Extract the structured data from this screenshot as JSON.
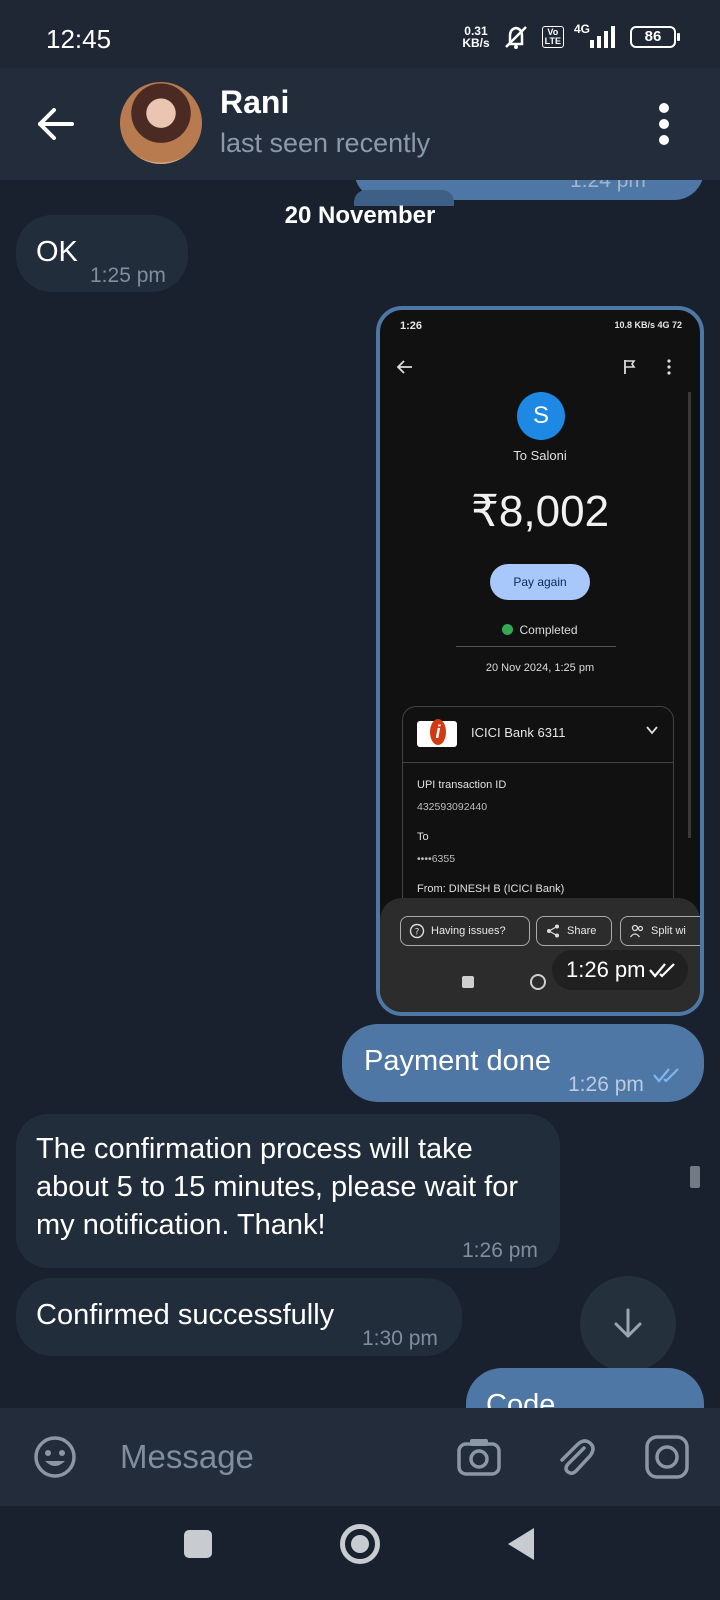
{
  "status_bar": {
    "time": "12:45",
    "speed_value": "0.31",
    "speed_unit": "KB/s",
    "volte_top": "Vo",
    "volte_bottom": "LTE",
    "network": "4G",
    "battery": "86"
  },
  "header": {
    "contact_name": "Rani",
    "contact_status": "last seen recently"
  },
  "chat": {
    "partial_time": "1:24 pm",
    "date_separator": "20 November",
    "messages": [
      {
        "direction": "incoming",
        "text": "OK",
        "time": "1:25 pm"
      },
      {
        "direction": "outgoing",
        "type": "image",
        "time": "1:26 pm"
      },
      {
        "direction": "outgoing",
        "text": "Payment done",
        "time": "1:26 pm"
      },
      {
        "direction": "incoming",
        "text": "The confirmation process will take about 5 to 15 minutes, please wait for my notification. Thank!",
        "time": "1:26 pm"
      },
      {
        "direction": "incoming",
        "text": "Confirmed successfully",
        "time": "1:30 pm"
      },
      {
        "direction": "outgoing",
        "text": "Code",
        "time": ""
      }
    ]
  },
  "payment_screenshot": {
    "status_time": "1:26",
    "status_right": "10.8 KB/s  4G  72",
    "avatar_letter": "S",
    "recipient": "To Saloni",
    "amount": "₹8,002",
    "pay_again_label": "Pay again",
    "status": "Completed",
    "datetime": "20 Nov 2024, 1:25 pm",
    "bank": "ICICI Bank 6311",
    "upi_label": "UPI transaction ID",
    "upi_id": "432593092440",
    "to_label": "To",
    "to_value": "••••6355",
    "from_label": "From: DINESH B (ICICI Bank)",
    "chips": [
      "Having issues?",
      "Share",
      "Split wi"
    ]
  },
  "input": {
    "placeholder": "Message"
  }
}
